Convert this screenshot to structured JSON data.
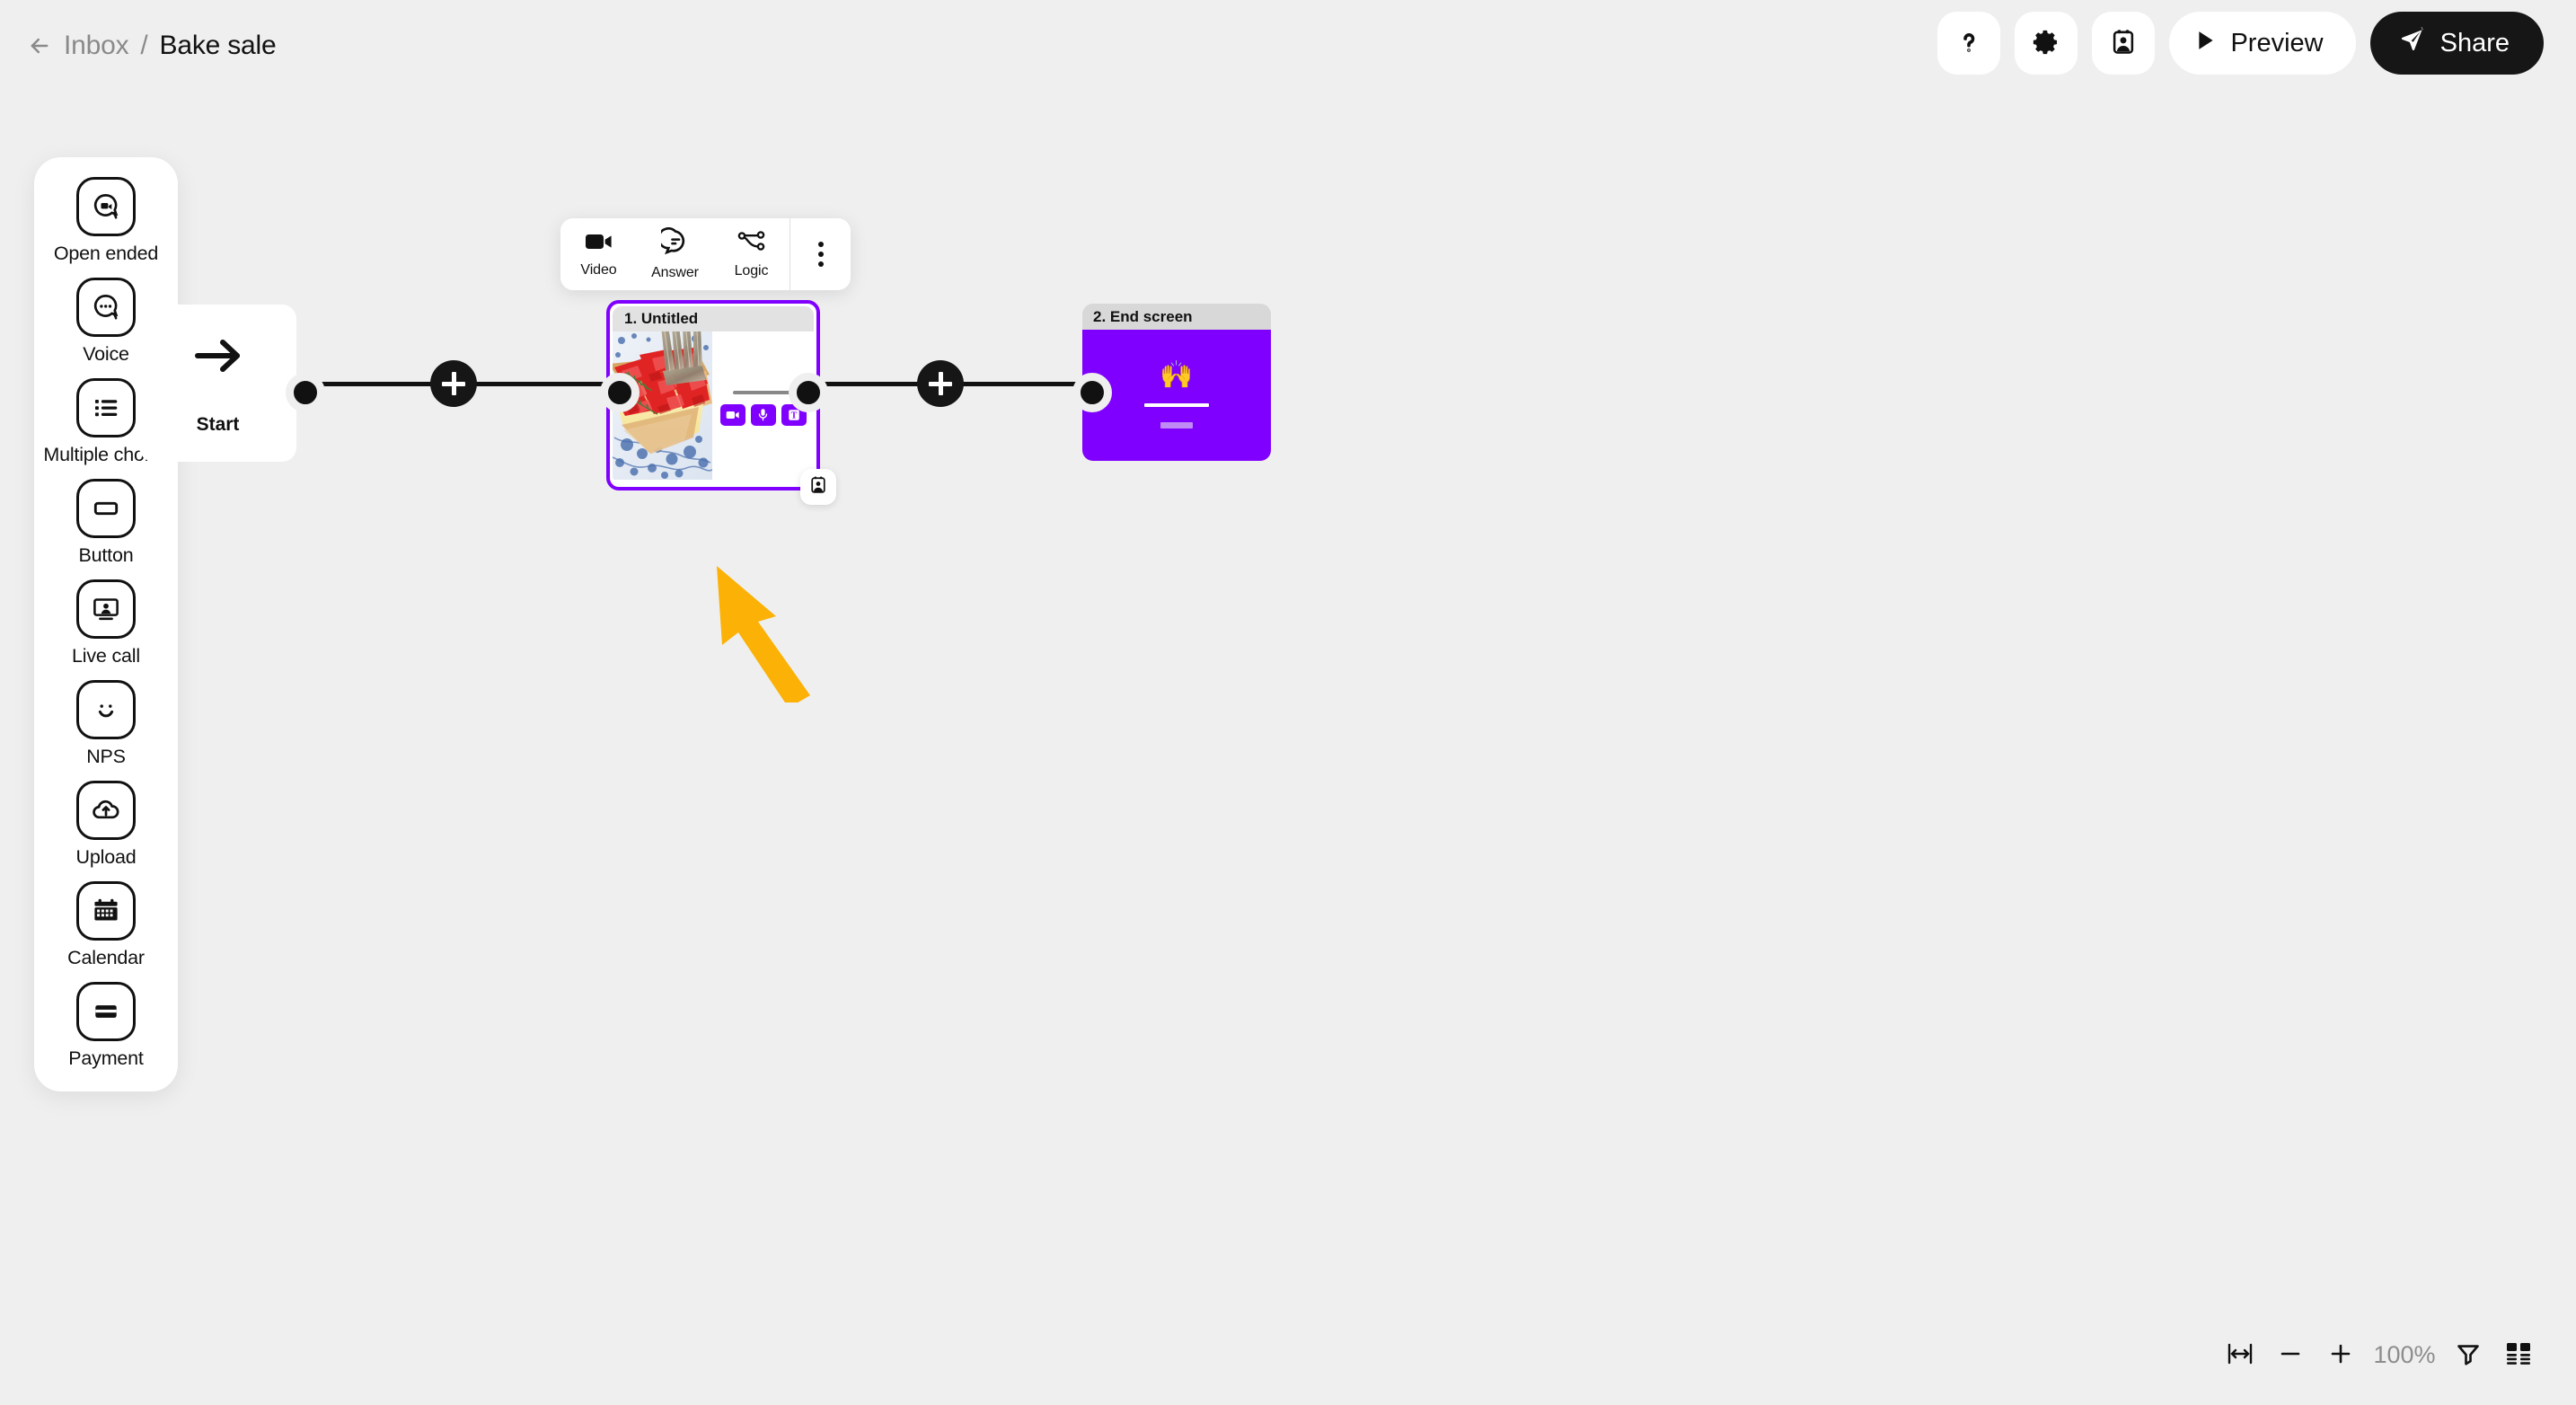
{
  "topbar": {
    "back_icon": "arrow-left-icon",
    "breadcrumb_parent": "Inbox",
    "breadcrumb_separator": "/",
    "breadcrumb_current": "Bake sale",
    "help_icon": "question-mark-icon",
    "settings_icon": "gear-icon",
    "respondent_icon": "badge-person-icon",
    "preview_label": "Preview",
    "preview_icon": "play-icon",
    "share_label": "Share",
    "share_icon": "send-paper-plane-icon"
  },
  "sidebar": {
    "items": [
      {
        "label": "Open ended",
        "icon": "chat-video-icon"
      },
      {
        "label": "Voice",
        "icon": "chat-dots-icon"
      },
      {
        "label": "Multiple choice",
        "icon": "list-bullets-icon"
      },
      {
        "label": "Button",
        "icon": "button-rectangle-icon"
      },
      {
        "label": "Live call",
        "icon": "monitor-person-icon"
      },
      {
        "label": "NPS",
        "icon": "smiley-face-icon"
      },
      {
        "label": "Upload",
        "icon": "cloud-upload-icon"
      },
      {
        "label": "Calendar",
        "icon": "calendar-icon"
      },
      {
        "label": "Payment",
        "icon": "credit-card-icon"
      }
    ]
  },
  "toolbar": {
    "items": [
      {
        "label": "Video",
        "icon": "video-camera-icon"
      },
      {
        "label": "Answer",
        "icon": "chat-answer-icon"
      },
      {
        "label": "Logic",
        "icon": "logic-branch-icon"
      }
    ],
    "more_icon": "three-dots-vertical-icon"
  },
  "canvas": {
    "start_card": {
      "label": "Start",
      "icon": "arrow-right-icon"
    },
    "question_card": {
      "title": "1. Untitled",
      "badge_icon": "badge-person-icon",
      "media_alt": "strawberry-tart-photo",
      "answer_buttons": [
        {
          "icon": "video-camera-icon"
        },
        {
          "icon": "microphone-icon"
        },
        {
          "icon": "text-t-icon"
        }
      ]
    },
    "end_card": {
      "title": "2. End screen",
      "emoji": "🙌"
    },
    "add_step_icon": "plus-icon",
    "annotation_arrow": "pointer-arrow-annotation"
  },
  "zoombar": {
    "fit_icon": "fit-to-width-icon",
    "zoom_out_icon": "minus-icon",
    "zoom_in_icon": "plus-icon",
    "zoom_level": "100%",
    "filter_icon": "funnel-filter-icon",
    "layout_icon": "layout-grid-icon"
  },
  "colors": {
    "accent_purple": "#8000ff",
    "canvas_bg": "#efefef",
    "annotation_amber": "#fbb105",
    "dark": "#161616"
  }
}
